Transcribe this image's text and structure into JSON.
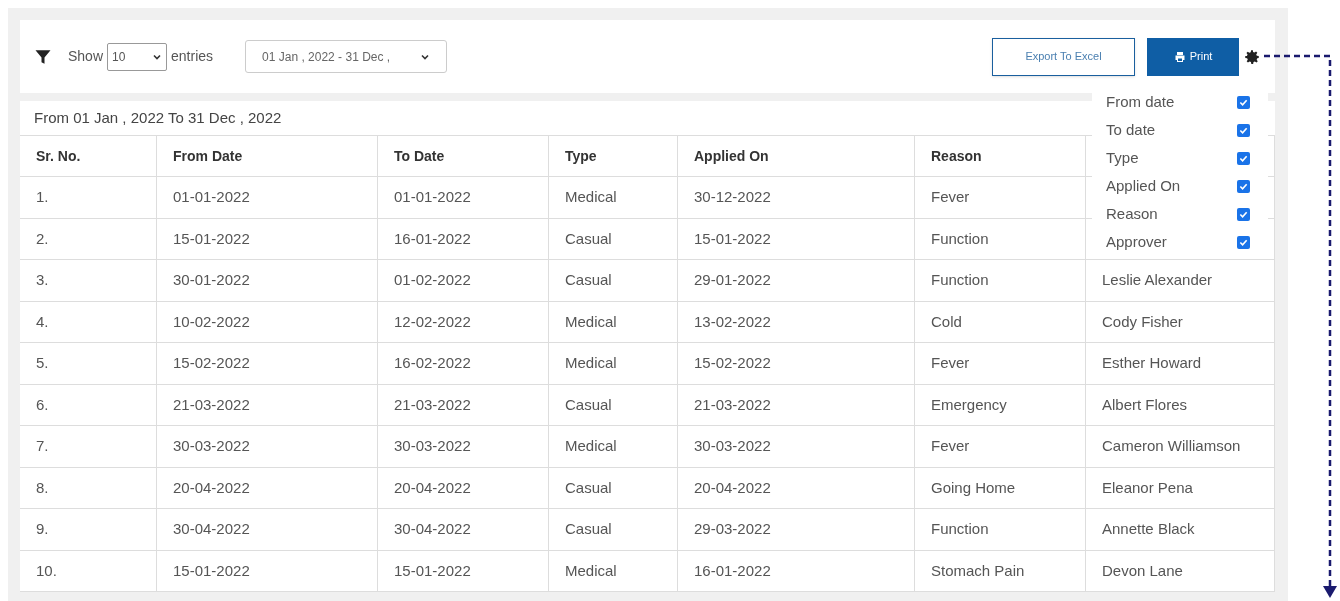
{
  "toolbar": {
    "show_label": "Show",
    "entries_value": "10",
    "entries_label": "entries",
    "date_range": "01 Jan , 2022 - 31 Dec ,",
    "export_button": "Export To Excel",
    "print_button": "Print"
  },
  "range_caption": "From 01 Jan , 2022 To 31 Dec , 2022",
  "table": {
    "columns": [
      "Sr. No.",
      "From Date",
      "To Date",
      "Type",
      "Applied On",
      "Reason"
    ],
    "rows": [
      {
        "cells": [
          "1.",
          "01-01-2022",
          "01-01-2022",
          "Medical",
          "30-12-2022",
          "Fever"
        ]
      },
      {
        "cells": [
          "2.",
          "15-01-2022",
          "16-01-2022",
          "Casual",
          "15-01-2022",
          "Function"
        ]
      },
      {
        "cells": [
          "3.",
          "30-01-2022",
          "01-02-2022",
          "Casual",
          "29-01-2022",
          "Function",
          "Leslie Alexander"
        ]
      },
      {
        "cells": [
          "4.",
          "10-02-2022",
          "12-02-2022",
          "Medical",
          "13-02-2022",
          "Cold",
          "Cody Fisher"
        ]
      },
      {
        "cells": [
          "5.",
          "15-02-2022",
          "16-02-2022",
          "Medical",
          "15-02-2022",
          "Fever",
          "Esther Howard"
        ]
      },
      {
        "cells": [
          "6.",
          "21-03-2022",
          "21-03-2022",
          "Casual",
          "21-03-2022",
          "Emergency",
          "Albert Flores"
        ]
      },
      {
        "cells": [
          "7.",
          "30-03-2022",
          "30-03-2022",
          "Medical",
          "30-03-2022",
          "Fever",
          "Cameron Williamson"
        ]
      },
      {
        "cells": [
          "8.",
          "20-04-2022",
          "20-04-2022",
          "Casual",
          "20-04-2022",
          "Going Home",
          "Eleanor Pena"
        ]
      },
      {
        "cells": [
          "9.",
          "30-04-2022",
          "30-04-2022",
          "Casual",
          "29-03-2022",
          "Function",
          "Annette Black"
        ]
      },
      {
        "cells": [
          "10.",
          "15-01-2022",
          "15-01-2022",
          "Medical",
          "16-01-2022",
          "Stomach Pain",
          "Devon Lane"
        ]
      }
    ]
  },
  "column_menu": [
    {
      "label": "From date",
      "checked": true
    },
    {
      "label": "To date",
      "checked": true
    },
    {
      "label": "Type",
      "checked": true
    },
    {
      "label": "Applied On",
      "checked": true
    },
    {
      "label": "Reason",
      "checked": true
    },
    {
      "label": "Approver",
      "checked": true
    }
  ]
}
